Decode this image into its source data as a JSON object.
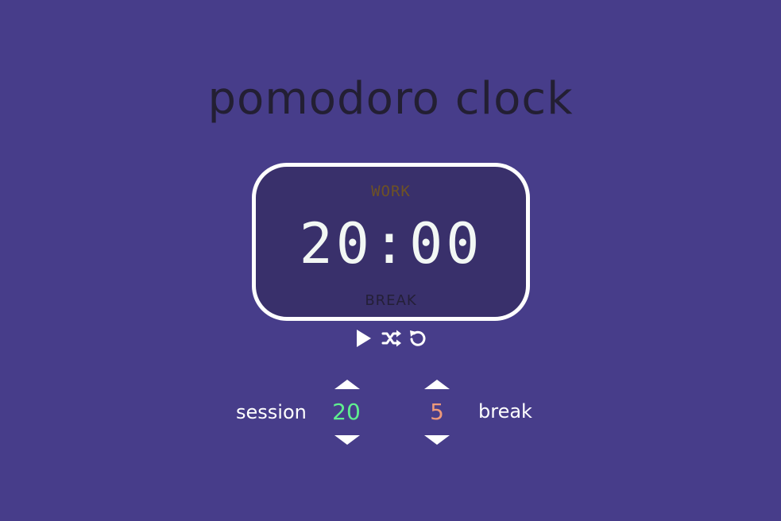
{
  "app": {
    "title": "pomodoro clock"
  },
  "clock": {
    "mode_work": "WORK",
    "time": "20:00",
    "mode_break": "BREAK"
  },
  "controls": {
    "play_icon": "play-icon",
    "shuffle_icon": "shuffle-icon",
    "reset_icon": "reset-icon"
  },
  "session": {
    "label": "session",
    "value": "20"
  },
  "break": {
    "label": "break",
    "value": "5"
  },
  "colors": {
    "background": "#473d8a",
    "clock_face": "#39306b",
    "work_indicator": "#6e5224",
    "session_value": "#5ff08f",
    "break_value": "#ee9979",
    "title": "#231f33"
  }
}
